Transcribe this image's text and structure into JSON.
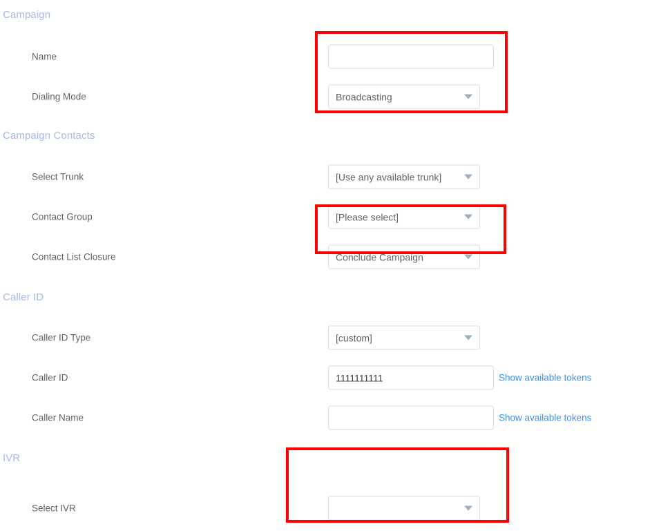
{
  "colors": {
    "section_header": "#a9b8e8",
    "label": "#5f6368",
    "link": "#3b8ef0",
    "field_border": "#d7dde5",
    "caret": "#9fadc0",
    "highlight": "#fe0000",
    "background": "#ffffff"
  },
  "sections": [
    {
      "id": "campaign",
      "title": "Campaign"
    },
    {
      "id": "campaign_contacts",
      "title": "Campaign Contacts"
    },
    {
      "id": "caller_id",
      "title": "Caller ID"
    },
    {
      "id": "ivr",
      "title": "IVR"
    }
  ],
  "fields": {
    "name": {
      "label": "Name",
      "type": "text",
      "value": "",
      "placeholder": ""
    },
    "dialing_mode": {
      "label": "Dialing Mode",
      "type": "select",
      "value": "Broadcasting"
    },
    "select_trunk": {
      "label": "Select Trunk",
      "type": "select",
      "value": "[Use any available trunk]"
    },
    "contact_group": {
      "label": "Contact Group",
      "type": "select",
      "value": "[Please select]"
    },
    "contact_list_closure": {
      "label": "Contact List Closure",
      "type": "select",
      "value": "Conclude Campaign"
    },
    "caller_id_type": {
      "label": "Caller ID Type",
      "type": "select",
      "value": "[custom]"
    },
    "caller_id": {
      "label": "Caller ID",
      "type": "text",
      "value": "1111111111",
      "placeholder": "",
      "token_link": "Show available tokens"
    },
    "caller_name": {
      "label": "Caller Name",
      "type": "text",
      "value": "",
      "placeholder": "",
      "token_link": "Show available tokens"
    },
    "select_ivr": {
      "label": "Select IVR",
      "type": "select",
      "value": ""
    }
  },
  "highlights": [
    {
      "id": "highlight-campaign-fields",
      "target": "Name and Dialing Mode fields"
    },
    {
      "id": "highlight-contact-group",
      "target": "Contact Group field"
    },
    {
      "id": "highlight-select-ivr",
      "target": "Select IVR field"
    }
  ]
}
